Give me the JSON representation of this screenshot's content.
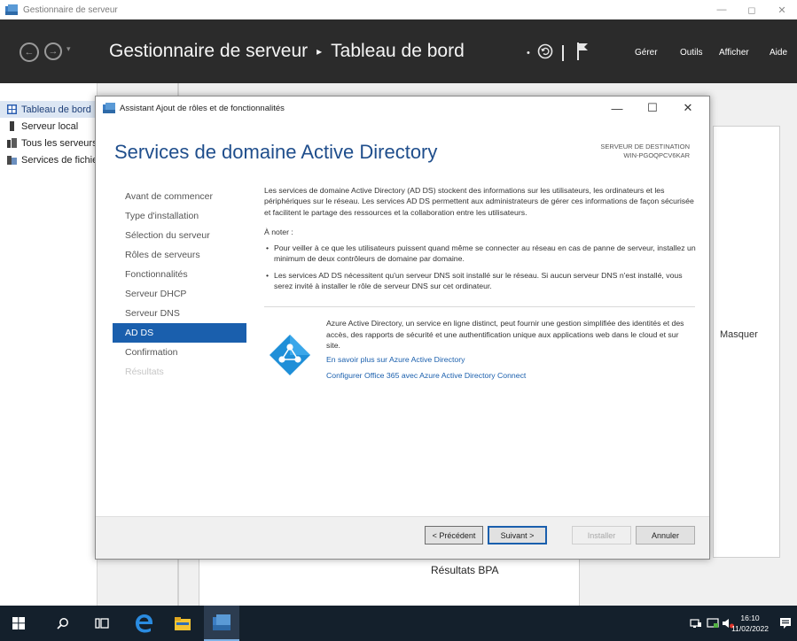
{
  "window": {
    "title": "Gestionnaire de serveur"
  },
  "header": {
    "breadcrumb_app": "Gestionnaire de serveur",
    "breadcrumb_sep": "▸",
    "breadcrumb_page": "Tableau de bord",
    "menu": [
      "Gérer",
      "Outils",
      "Afficher",
      "Aide"
    ]
  },
  "sidebar": {
    "items": [
      {
        "label": "Tableau de bord",
        "icon": "dashboard-icon"
      },
      {
        "label": "Serveur local",
        "icon": "server-icon"
      },
      {
        "label": "Tous les serveurs",
        "icon": "servers-icon"
      },
      {
        "label": "Services de fichiers et de stockage",
        "icon": "file-services-icon"
      }
    ]
  },
  "dashboard": {
    "masquer": "Masquer",
    "bpa": "Résultats BPA"
  },
  "dialog": {
    "title": "Assistant Ajout de rôles et de fonctionnalités",
    "heading": "Services de domaine Active Directory",
    "dest_label": "SERVEUR DE DESTINATION",
    "dest_server": "WIN-PGOQPCV6KAR",
    "steps": [
      {
        "label": "Avant de commencer",
        "state": "normal"
      },
      {
        "label": "Type d'installation",
        "state": "normal"
      },
      {
        "label": "Sélection du serveur",
        "state": "normal"
      },
      {
        "label": "Rôles de serveurs",
        "state": "normal"
      },
      {
        "label": "Fonctionnalités",
        "state": "normal"
      },
      {
        "label": "Serveur DHCP",
        "state": "normal"
      },
      {
        "label": "Serveur DNS",
        "state": "normal"
      },
      {
        "label": "AD DS",
        "state": "current"
      },
      {
        "label": "Confirmation",
        "state": "normal"
      },
      {
        "label": "Résultats",
        "state": "disabled"
      }
    ],
    "intro": "Les services de domaine Active Directory (AD DS) stockent des informations sur les utilisateurs, les ordinateurs et les périphériques sur le réseau. Les services AD DS permettent aux administrateurs de gérer ces informations de façon sécurisée et facilitent le partage des ressources et la collaboration entre les utilisateurs.",
    "note_label": "À noter :",
    "notes": [
      "Pour veiller à ce que les utilisateurs puissent quand même se connecter au réseau en cas de panne de serveur, installez un minimum de deux contrôleurs de domaine par domaine.",
      "Les services AD DS nécessitent qu'un serveur DNS soit installé sur le réseau. Si aucun serveur DNS n'est installé, vous serez invité à installer le rôle de serveur DNS sur cet ordinateur."
    ],
    "azure_text": "Azure Active Directory, un service en ligne distinct, peut fournir une gestion simplifiée des identités et des accès, des rapports de sécurité et une authentification unique aux applications web dans le cloud et sur site.",
    "azure_link1": "En savoir plus sur Azure Active Directory",
    "azure_link2": "Configurer Office 365 avec Azure Active Directory Connect",
    "buttons": {
      "prev": "< Précédent",
      "next": "Suivant >",
      "install": "Installer",
      "cancel": "Annuler"
    }
  },
  "taskbar": {
    "time": "16:10",
    "date": "11/02/2022"
  },
  "colors": {
    "accent": "#1a5fad",
    "header_bg": "#2b2b2b",
    "taskbar_bg": "#14202c",
    "heading": "#1f4e8c"
  }
}
